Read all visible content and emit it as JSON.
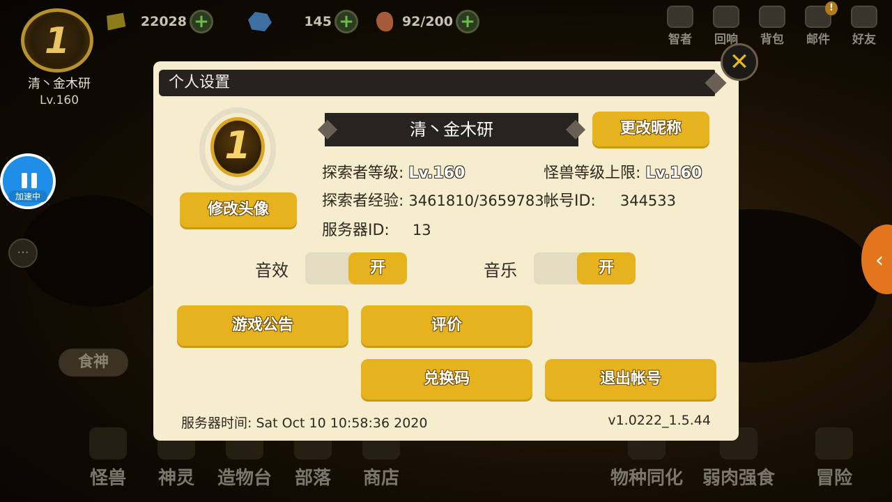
{
  "player": {
    "rank": "1",
    "name": "清丶金木研",
    "level": "Lv.160"
  },
  "resources": [
    {
      "icon": "gold-ingot-icon",
      "value": "22028"
    },
    {
      "icon": "crystal-gem-icon",
      "value": "145"
    },
    {
      "icon": "meat-stamina-icon",
      "value": "92/200"
    }
  ],
  "top_menu": [
    {
      "icon": "lightbulb-icon",
      "label": "智者"
    },
    {
      "icon": "echo-cards-icon",
      "label": "回响"
    },
    {
      "icon": "backpack-icon",
      "label": "背包"
    },
    {
      "icon": "mail-icon",
      "label": "邮件"
    },
    {
      "icon": "friends-icon",
      "label": "好友"
    }
  ],
  "speed_button": {
    "label": "加速中"
  },
  "side_labels": {
    "food_god": "食神"
  },
  "bottom_nav_left": [
    {
      "icon": "monster-icon",
      "label": "怪兽"
    },
    {
      "icon": "deity-icon",
      "label": "神灵"
    },
    {
      "icon": "crafting-table-icon",
      "label": "造物台"
    },
    {
      "icon": "tribe-icon",
      "label": "部落"
    },
    {
      "icon": "shop-icon",
      "label": "商店"
    }
  ],
  "bottom_nav_right": [
    {
      "icon": "species-assimilation-icon",
      "label": "物种同化"
    },
    {
      "icon": "survival-icon",
      "label": "弱肉强食"
    },
    {
      "icon": "compass-icon",
      "label": "冒险"
    }
  ],
  "dialog": {
    "title": "个人设置",
    "nickname": "清丶金木研",
    "change_nickname": "更改昵称",
    "change_avatar": "修改头像",
    "avatar_rank": "1",
    "explorer_level_label": "探索者等级:",
    "explorer_level_value": "Lv.160",
    "monster_cap_label": "怪兽等级上限:",
    "monster_cap_value": "Lv.160",
    "explorer_exp_label": "探索者经验:",
    "explorer_exp_value": "3461810/3659783",
    "account_id_label": "帐号ID:",
    "account_id_value": "344533",
    "server_id_label": "服务器ID:",
    "server_id_value": "13",
    "sound_label": "音效",
    "sound_state": "开",
    "music_label": "音乐",
    "music_state": "开",
    "btn_announcement": "游戏公告",
    "btn_review": "评价",
    "btn_redeem": "兑换码",
    "btn_logout": "退出帐号",
    "server_time": "服务器时间: Sat Oct 10 10:58:36 2020",
    "version": "v1.0222_1.5.44"
  }
}
